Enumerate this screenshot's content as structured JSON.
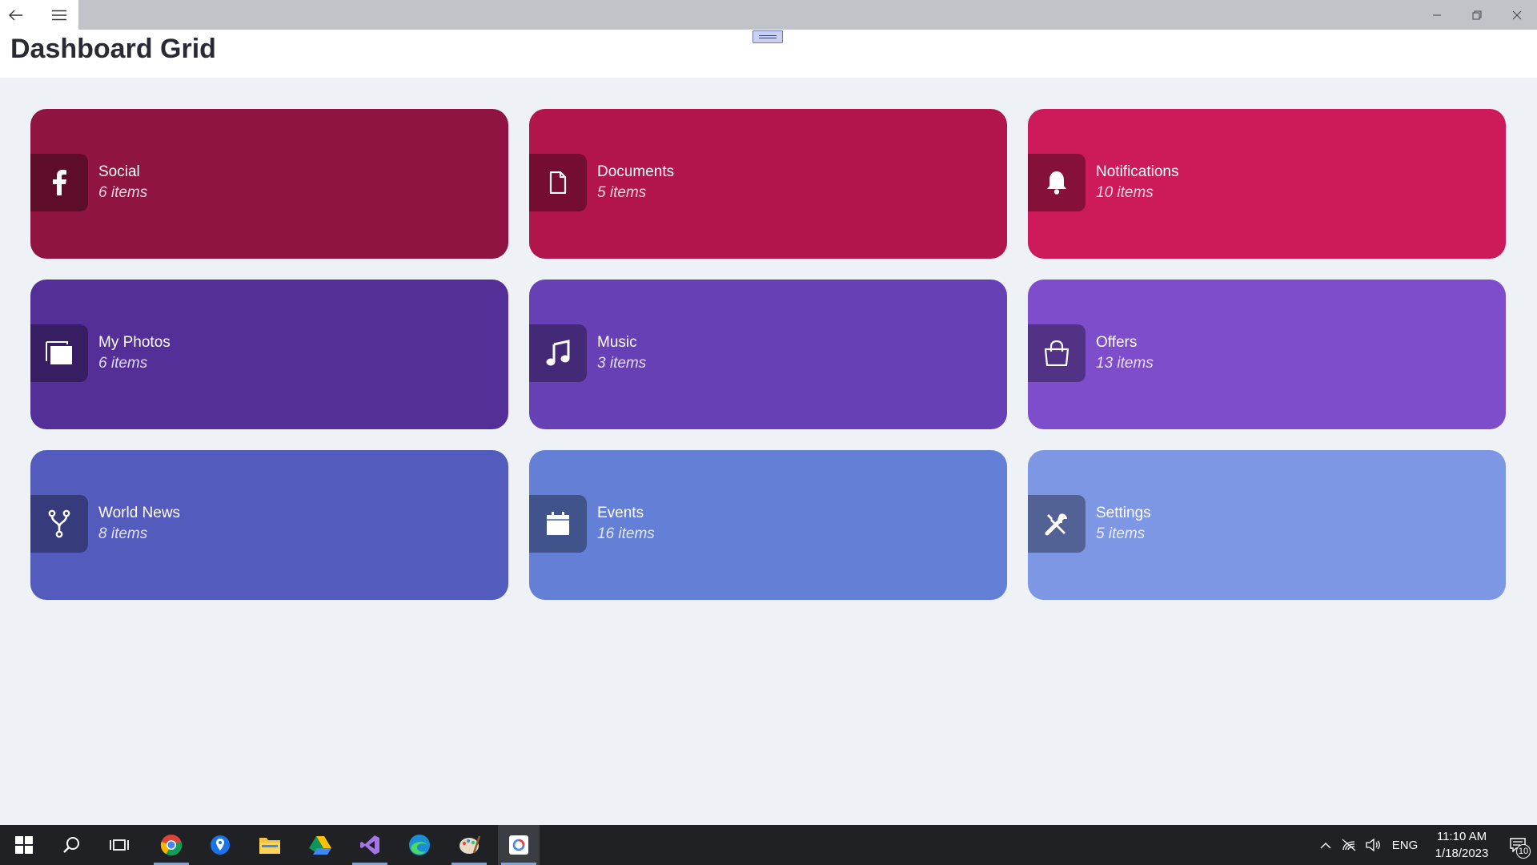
{
  "window": {
    "back_icon": "back-arrow-icon",
    "menu_icon": "hamburger-menu-icon",
    "controls": [
      "minimize-icon",
      "restore-icon",
      "close-icon"
    ]
  },
  "page": {
    "title": "Dashboard Grid"
  },
  "cards": [
    {
      "title": "Social",
      "subtitle": "6 items",
      "icon": "facebook-icon",
      "color": "#8f1441"
    },
    {
      "title": "Documents",
      "subtitle": "5 items",
      "icon": "document-icon",
      "color": "#b2144c"
    },
    {
      "title": "Notifications",
      "subtitle": "10 items",
      "icon": "bell-icon",
      "color": "#cd1a5a"
    },
    {
      "title": "My Photos",
      "subtitle": "6 items",
      "icon": "photos-icon",
      "color": "#552f98"
    },
    {
      "title": "Music",
      "subtitle": "3 items",
      "icon": "music-note-icon",
      "color": "#6840b6"
    },
    {
      "title": "Offers",
      "subtitle": "13 items",
      "icon": "shopping-bag-icon",
      "color": "#7d4dcc"
    },
    {
      "title": "World News",
      "subtitle": "8 items",
      "icon": "fork-icon",
      "color": "#535cbd"
    },
    {
      "title": "Events",
      "subtitle": "16 items",
      "icon": "calendar-icon",
      "color": "#6380d6"
    },
    {
      "title": "Settings",
      "subtitle": "5 items",
      "icon": "tools-icon",
      "color": "#7e97e4"
    }
  ],
  "taskbar": {
    "apps": [
      "windows-start-icon",
      "search-icon",
      "task-view-icon",
      "chrome-icon",
      "maps-icon",
      "file-explorer-icon",
      "google-drive-icon",
      "visual-studio-icon",
      "edge-icon",
      "paint-icon",
      "app-icon"
    ],
    "tray": {
      "language": "ENG",
      "time": "11:10 AM",
      "date": "1/18/2023",
      "notification_count": "10"
    }
  }
}
